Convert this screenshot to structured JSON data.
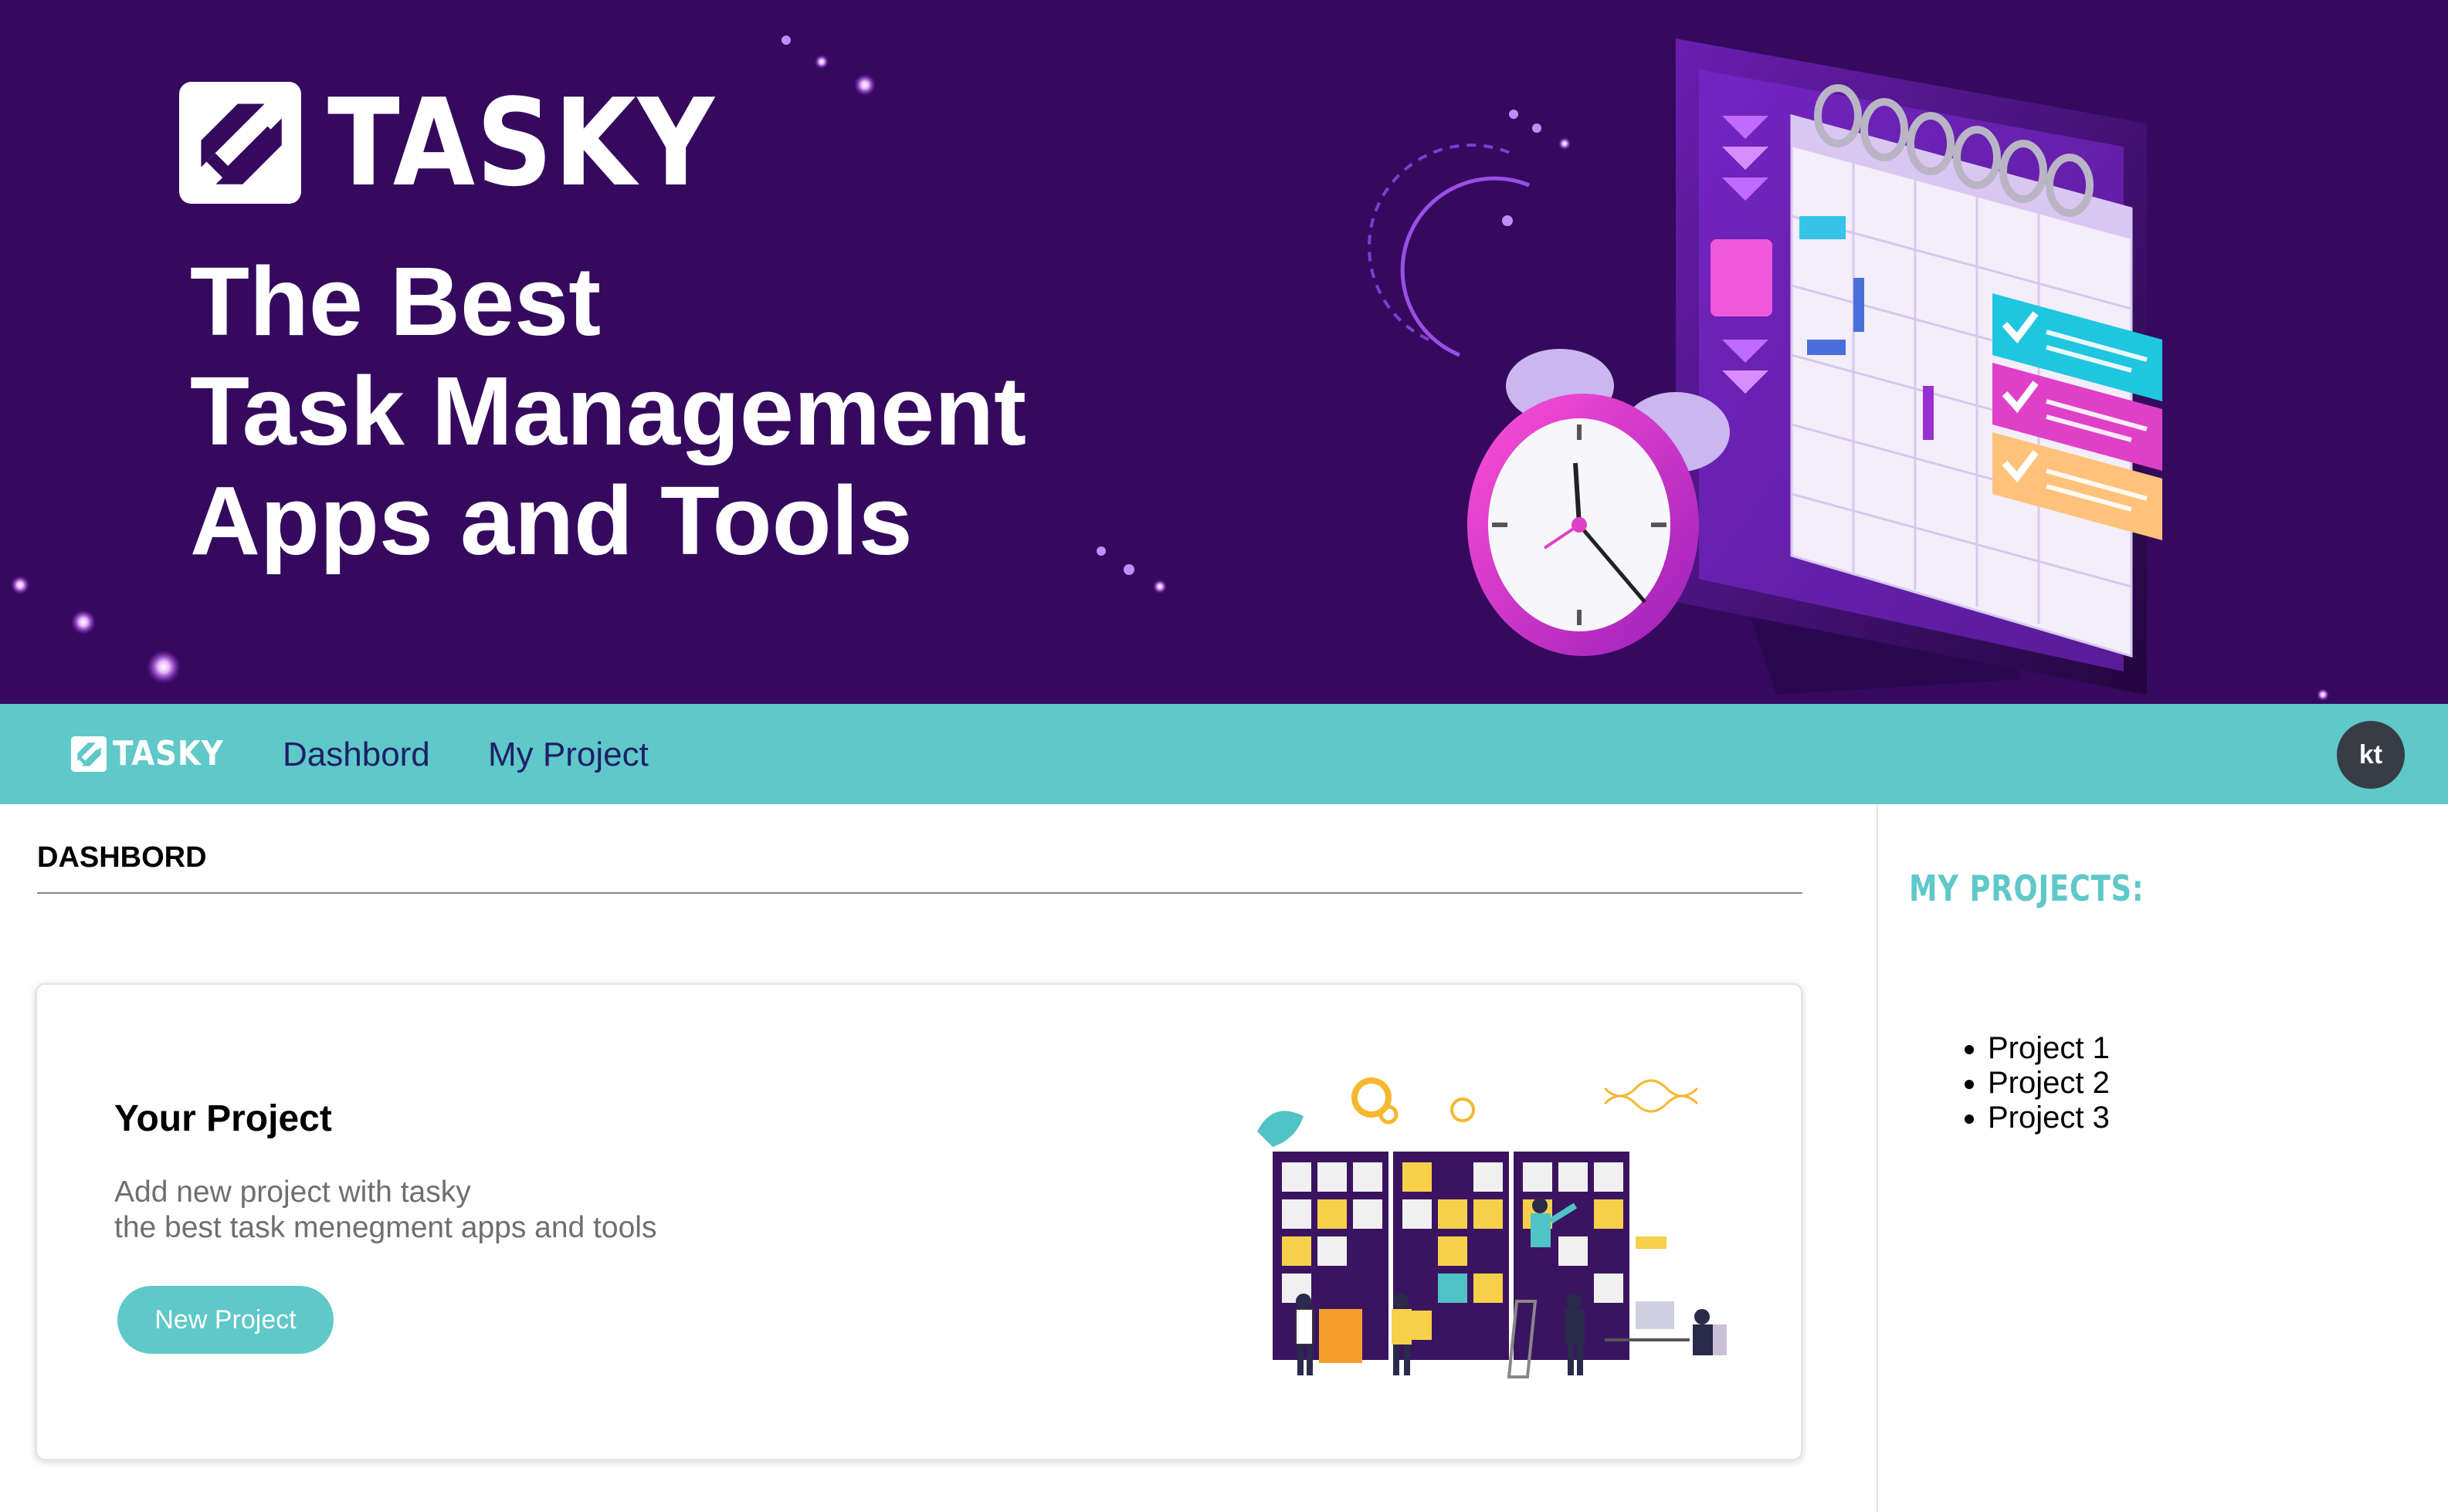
{
  "hero": {
    "brand": "TASKY",
    "heading_lines": [
      "The Best",
      "Task Management",
      "Apps and Tools"
    ]
  },
  "nav": {
    "brand": "TASKY",
    "links": [
      "Dashbord",
      "My Project"
    ],
    "avatar_initials": "kt"
  },
  "main": {
    "page_title": "DASHBORD",
    "card": {
      "title": "Your Project",
      "description_lines": [
        "Add new project with tasky",
        "the best task menegment apps and tools"
      ],
      "button_label": "New Project"
    }
  },
  "sidebar": {
    "title": "MY PROJECTS:",
    "projects": [
      "Project 1",
      "Project 2",
      "Project 3"
    ]
  },
  "colors": {
    "hero_bg": "#350a5e",
    "accent_teal": "#5fc8c9",
    "nav_link": "#1f1f66",
    "avatar_bg": "#363d46"
  },
  "icons": {
    "logo": "tasky-check-logo-icon",
    "hero_illustration": "calendar-monitor-alarm-clock-illustration",
    "card_illustration": "team-task-board-illustration"
  }
}
